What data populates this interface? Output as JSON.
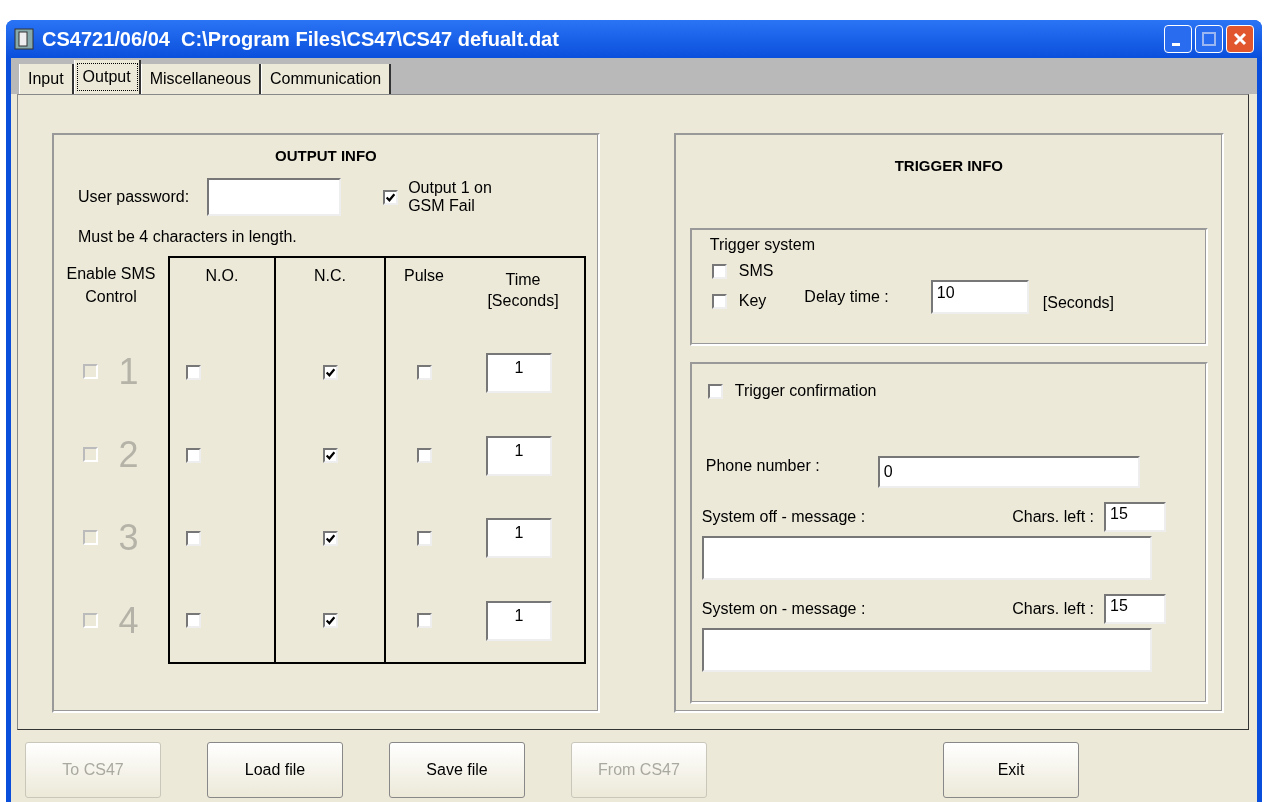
{
  "window": {
    "title": "CS4721/06/04  C:\\Program Files\\CS47\\CS47 defualt.dat"
  },
  "tabs": [
    {
      "label": "Input",
      "selected": false
    },
    {
      "label": "Output",
      "selected": true
    },
    {
      "label": "Miscellaneous",
      "selected": false
    },
    {
      "label": "Communication",
      "selected": false
    }
  ],
  "output_info": {
    "heading": "OUTPUT INFO",
    "password_label": "User password:",
    "gsm_fail": {
      "label": "Output 1 on GSM Fail",
      "checked": true
    },
    "hint": "Must be 4 characters in length.",
    "columns": [
      "Enable SMS Control",
      "N.O.",
      "N.C.",
      "Pulse",
      "Time [Seconds]"
    ],
    "rows": [
      {
        "number": "1",
        "sms": {
          "checked": false,
          "disabled": true
        },
        "no": false,
        "nc": true,
        "pulse": false,
        "time": "1"
      },
      {
        "number": "2",
        "sms": {
          "checked": false,
          "disabled": true
        },
        "no": false,
        "nc": true,
        "pulse": false,
        "time": "1"
      },
      {
        "number": "3",
        "sms": {
          "checked": false,
          "disabled": true
        },
        "no": false,
        "nc": true,
        "pulse": false,
        "time": "1"
      },
      {
        "number": "4",
        "sms": {
          "checked": false,
          "disabled": true
        },
        "no": false,
        "nc": true,
        "pulse": false,
        "time": "1"
      }
    ]
  },
  "trigger_info": {
    "heading": "TRIGGER INFO",
    "trigger_system": {
      "title": "Trigger system",
      "sms": {
        "label": "SMS",
        "checked": false
      },
      "key": {
        "label": "Key",
        "checked": false
      },
      "delay_label": "Delay time :",
      "delay_value": "10",
      "delay_unit": "[Seconds]"
    },
    "confirmation": {
      "label": "Trigger confirmation",
      "checked": false,
      "phone_label": "Phone number :",
      "phone_value": "0",
      "messages": [
        {
          "label": "System off - message :",
          "chars_label": "Chars. left :",
          "chars_value": "15"
        },
        {
          "label": "System on - message :",
          "chars_label": "Chars. left :",
          "chars_value": "15"
        }
      ]
    }
  },
  "buttons": [
    {
      "label": "To CS47",
      "disabled": true
    },
    {
      "label": "Load file",
      "disabled": false
    },
    {
      "label": "Save file",
      "disabled": false
    },
    {
      "label": "From CS47",
      "disabled": true
    },
    {
      "label": "Exit",
      "disabled": false
    }
  ]
}
